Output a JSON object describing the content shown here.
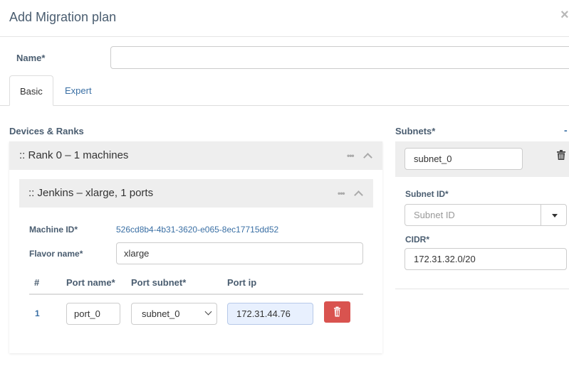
{
  "dialog": {
    "title": "Add Migration plan"
  },
  "name_field": {
    "label": "Name*",
    "value": "",
    "placeholder": ""
  },
  "tabs": [
    {
      "label": "Basic",
      "active": true
    },
    {
      "label": "Expert",
      "active": false
    }
  ],
  "devices": {
    "section_label": "Devices & Ranks",
    "rank": {
      "title": ":: Rank 0 – 1 machines",
      "machine": {
        "title": ":: Jenkins – xlarge, 1 ports",
        "machine_id_label": "Machine ID*",
        "machine_id_value": "526cd8b4-4b31-3620-e065-8ec17715dd52",
        "flavor_label": "Flavor name*",
        "flavor_value": "xlarge",
        "ports_table": {
          "headers": [
            "#",
            "Port name*",
            "Port subnet*",
            "Port ip"
          ],
          "rows": [
            {
              "num": "1",
              "port_name": "port_0",
              "port_subnet": "subnet_0",
              "port_ip": "172.31.44.76"
            }
          ]
        }
      }
    }
  },
  "subnets": {
    "section_label": "Subnets*",
    "items": [
      {
        "name": "subnet_0",
        "subnet_id_label": "Subnet ID*",
        "subnet_id_placeholder": "Subnet ID",
        "cidr_label": "CIDR*",
        "cidr_value": "172.31.32.0/20"
      }
    ]
  },
  "icons": {
    "close": "close-icon",
    "dots": "ellipsis-icon",
    "collapse": "chevron-up-icon",
    "delete": "trash-icon",
    "dropdown": "caret-down-icon"
  },
  "colors": {
    "danger": "#d9534f",
    "label": "#4a5d70",
    "link": "#3a6fa4",
    "panel_header": "#eeeeee"
  }
}
